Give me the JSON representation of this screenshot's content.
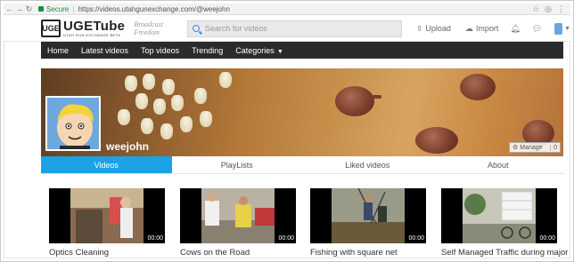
{
  "browser": {
    "secure_label": "Secure",
    "url": "https://videos.utahgunexchange.com/@weejohn"
  },
  "header": {
    "logo_mark": "UGE",
    "logo_name": "UGETube",
    "logo_sub": "UTAH GUN EXCHANGE   BETA",
    "tagline": "Broadcast Freedom",
    "search_placeholder": "Search for videos",
    "upload_label": "Upload",
    "import_label": "Import"
  },
  "nav": {
    "items": [
      "Home",
      "Latest videos",
      "Top videos",
      "Trending"
    ],
    "categories_label": "Categories"
  },
  "channel": {
    "username": "weejohn",
    "manage_label": "Manage",
    "manage_count": "0"
  },
  "tabs": [
    "Videos",
    "PlayLists",
    "Liked videos",
    "About"
  ],
  "videos": [
    {
      "title": "Optics Cleaning",
      "duration": "00:00"
    },
    {
      "title": "Cows on the Road",
      "duration": "00:00"
    },
    {
      "title": "Fishing with square net",
      "duration": "00:00"
    },
    {
      "title": "Self Managed Traffic during major",
      "duration": "00:00"
    }
  ],
  "colors": {
    "nav_bg": "#2b2b2b",
    "tab_active": "#1da1e6",
    "secure_green": "#1e8e3e"
  }
}
